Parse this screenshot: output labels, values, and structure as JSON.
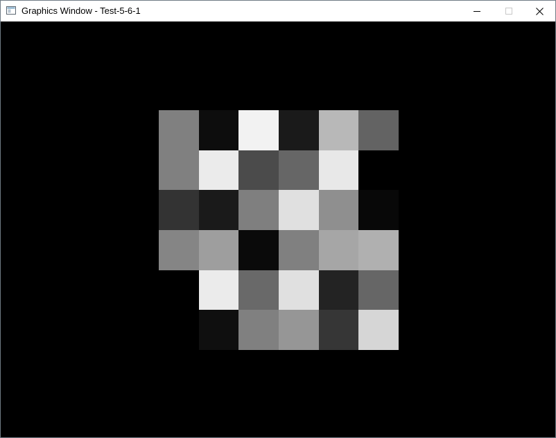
{
  "window": {
    "title": "Graphics Window - Test-5-6-1",
    "icon": "app-window-icon",
    "controls": {
      "minimize_icon": "minimize-icon",
      "maximize_icon": "maximize-icon",
      "close_icon": "close-icon"
    }
  },
  "canvas": {
    "background": "#000000",
    "grid": {
      "rows": 6,
      "cols": 6,
      "colors": [
        [
          "#808080",
          "#0d0d0d",
          "#f2f2f2",
          "#1a1a1a",
          "#b8b8b8",
          "#636363"
        ],
        [
          "#808080",
          "#ebebeb",
          "#4b4b4b",
          "#666666",
          "#e8e8e8",
          "#000000"
        ],
        [
          "#333333",
          "#1a1a1a",
          "#7f7f7f",
          "#e0e0e0",
          "#8f8f8f",
          "#080808"
        ],
        [
          "#858585",
          "#9e9e9e",
          "#0a0a0a",
          "#808080",
          "#a6a6a6",
          "#b0b0b0"
        ],
        [
          "#000000",
          "#ebebeb",
          "#696969",
          "#e0e0e0",
          "#232323",
          "#666666"
        ],
        [
          "#000000",
          "#0f0f0f",
          "#808080",
          "#969696",
          "#363636",
          "#d6d6d6"
        ]
      ]
    }
  }
}
